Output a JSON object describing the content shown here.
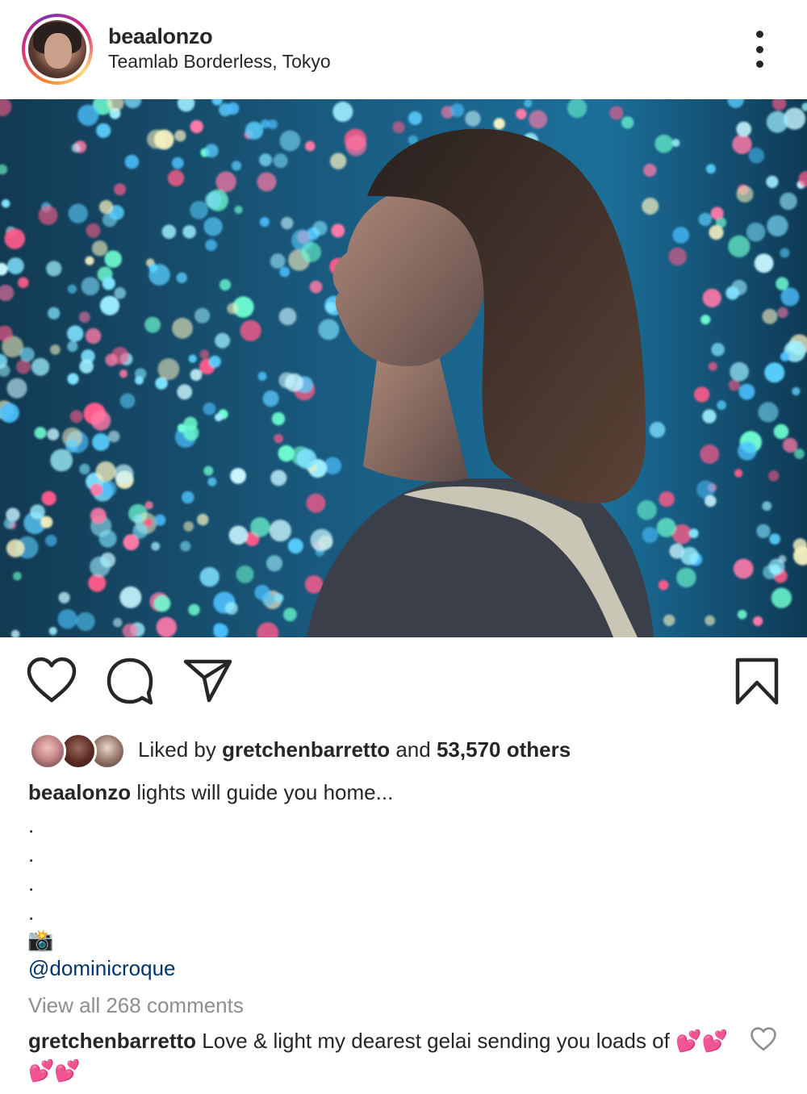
{
  "post": {
    "username": "beaalonzo",
    "location": "Teamlab Borderless, Tokyo"
  },
  "likes": {
    "prefix": "Liked by ",
    "user": "gretchenbarretto",
    "middle": " and ",
    "count": "53,570 others"
  },
  "caption": {
    "username": "beaalonzo",
    "text": " lights will guide you home...",
    "dots": [
      ".",
      ".",
      ".",
      "."
    ],
    "emoji": "📸",
    "mention": "@dominicroque"
  },
  "comments": {
    "view_all": "View all 268 comments",
    "items": [
      {
        "username": "gretchenbarretto",
        "text": " Love & light my dearest gelai  sending you loads of ",
        "emoji": "💕💕💕💕"
      }
    ]
  },
  "icons": {
    "like": "heart-icon",
    "comment": "comment-bubble-icon",
    "share": "paper-plane-icon",
    "save": "bookmark-icon",
    "more": "vertical-dots-icon"
  },
  "colors": {
    "text": "#262626",
    "secondary": "#8e8e8e",
    "link": "#003569",
    "ring_start": "#f58529",
    "ring_mid": "#dd2a7b"
  }
}
